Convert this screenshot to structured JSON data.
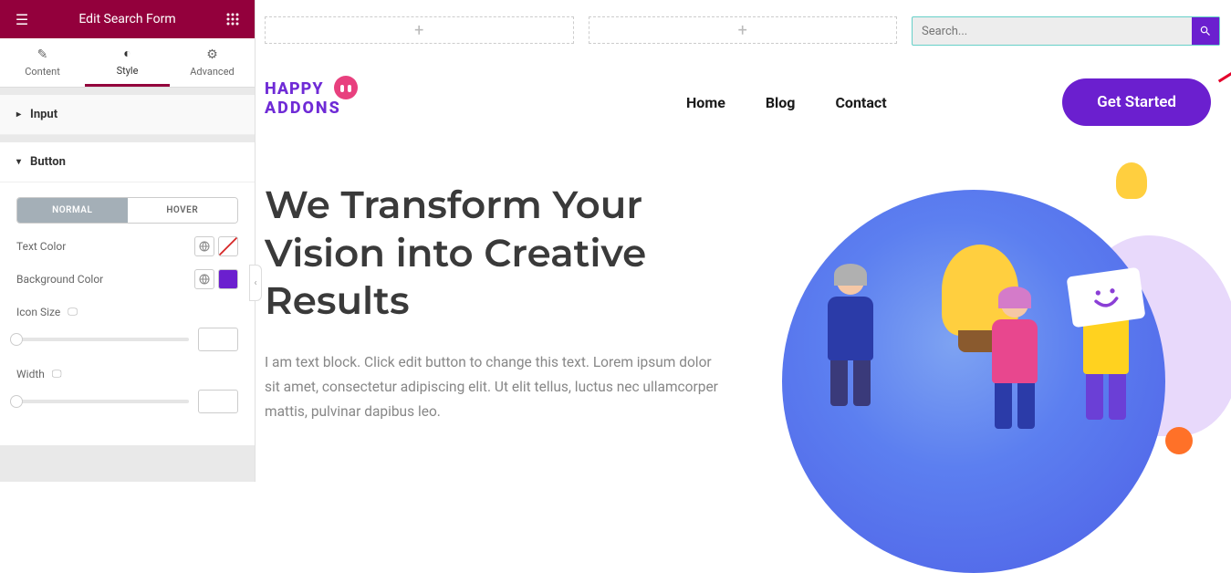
{
  "panel": {
    "title": "Edit Search Form",
    "tabs": [
      {
        "label": "Content",
        "active": false
      },
      {
        "label": "Style",
        "active": true
      },
      {
        "label": "Advanced",
        "active": false
      }
    ],
    "sections": {
      "input": {
        "label": "Input",
        "open": false
      },
      "button": {
        "label": "Button",
        "open": true
      }
    },
    "button": {
      "subtabs": {
        "normal": "NORMAL",
        "hover": "HOVER",
        "active": "normal"
      },
      "text_color_label": "Text Color",
      "text_color": "",
      "bg_color_label": "Background Color",
      "bg_color": "#6b1fcf",
      "icon_size_label": "Icon Size",
      "icon_size": "",
      "width_label": "Width",
      "width": ""
    }
  },
  "canvas": {
    "search_placeholder": "Search...",
    "logo_top": "HAPPY",
    "logo_bottom": "ADDONS",
    "nav": [
      "Home",
      "Blog",
      "Contact"
    ],
    "cta": "Get Started",
    "hero_title": "We Transform Your Vision into Creative Results",
    "hero_body": "I am text block. Click edit button to change this text. Lorem ipsum dolor sit amet, consectetur adipiscing elit. Ut elit tellus, luctus nec ullamcorper mattis, pulvinar dapibus leo."
  }
}
